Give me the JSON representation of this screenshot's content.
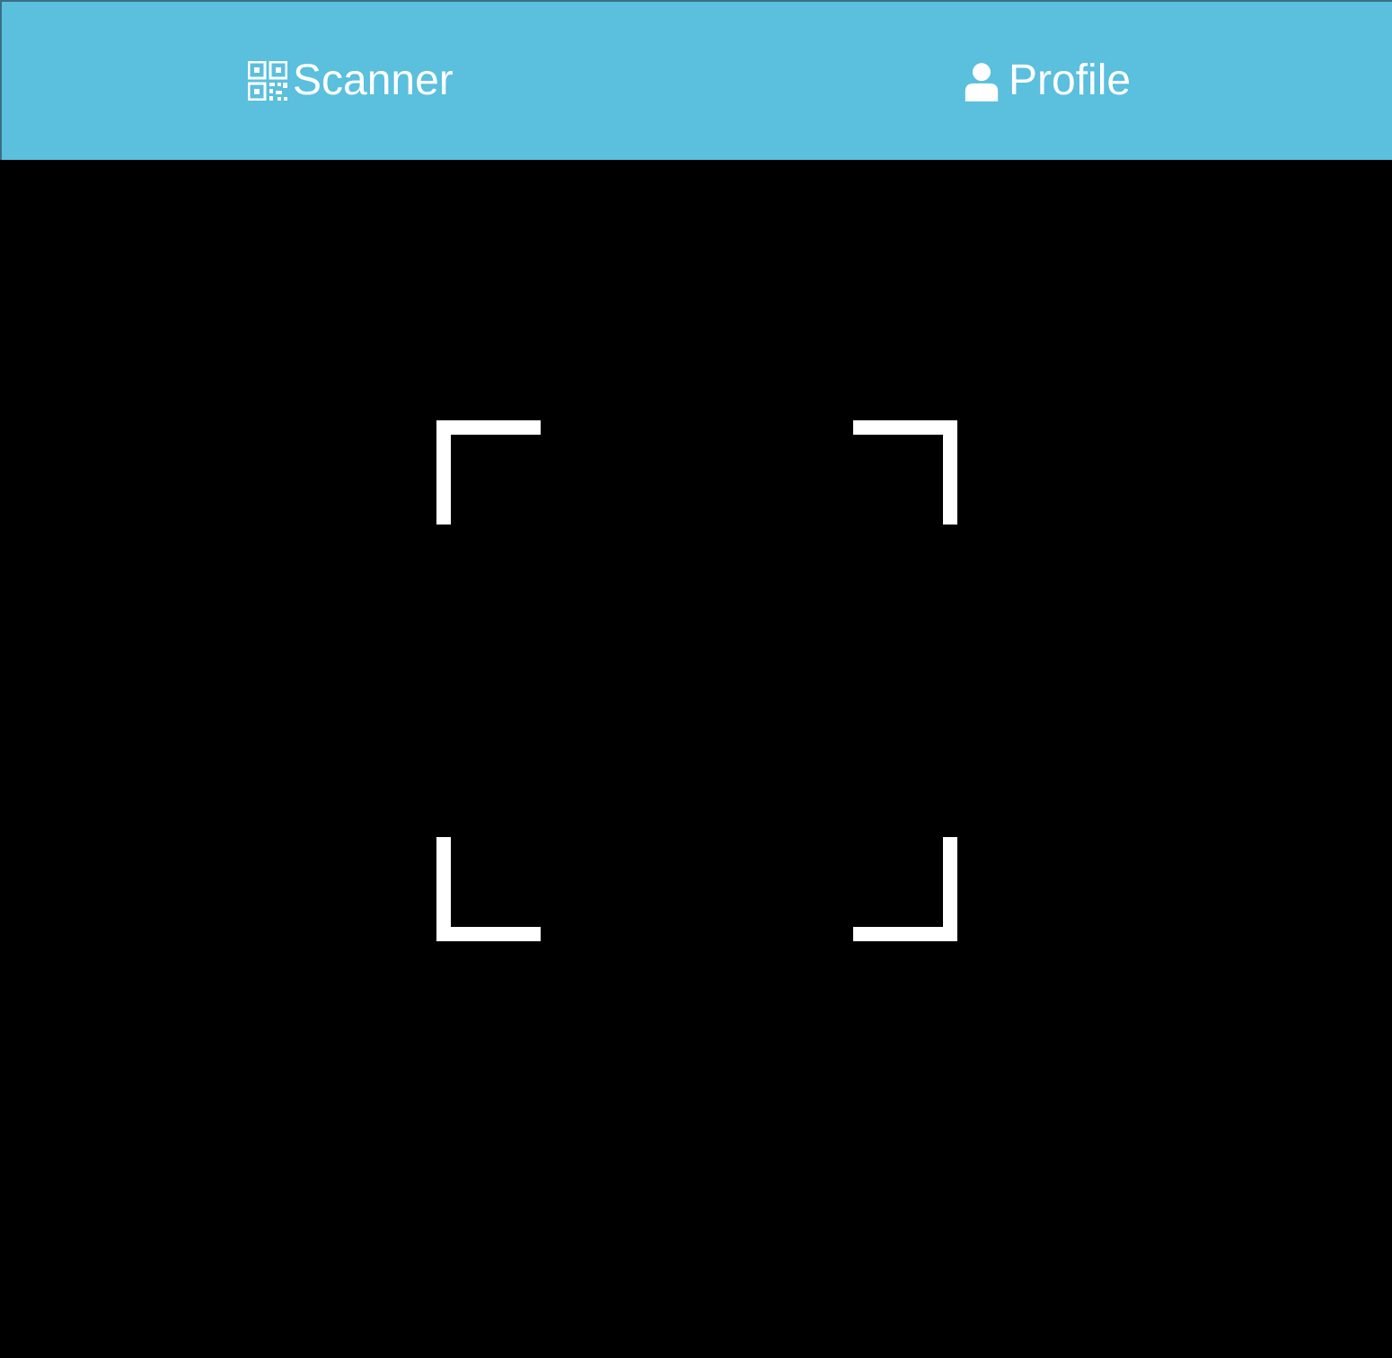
{
  "tabbar": {
    "background": "#5bbfde",
    "tabs": [
      {
        "label": "Scanner",
        "icon": "qr-code-icon"
      },
      {
        "label": "Profile",
        "icon": "user-icon"
      }
    ]
  },
  "camera": {
    "background": "#000000",
    "viewfinder_color": "#ffffff"
  }
}
